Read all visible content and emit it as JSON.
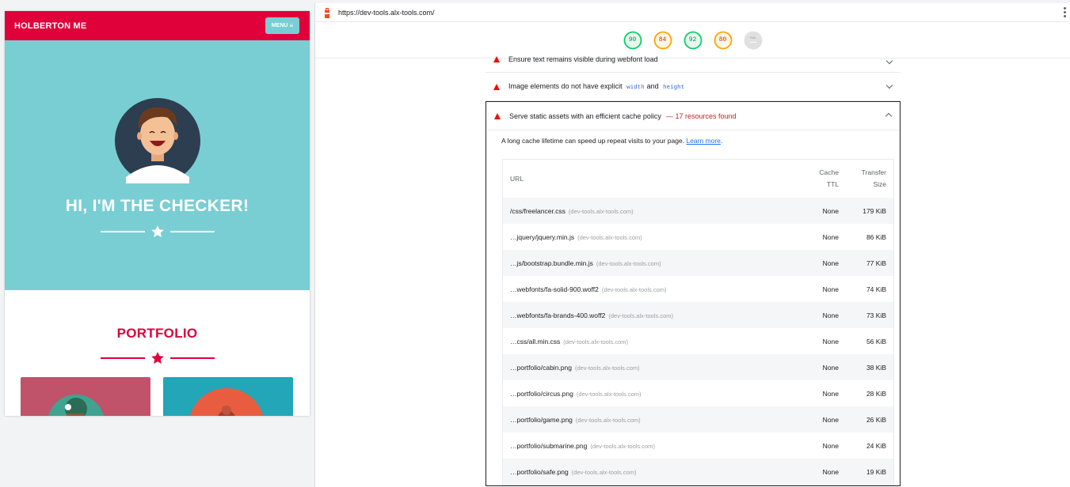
{
  "preview": {
    "brand": "HOLBERTON ME",
    "menu_label": "MENU",
    "hero_title": "HI, I'M THE CHECKER!",
    "portfolio_title": "PORTFOLIO"
  },
  "devtools": {
    "url": "https://dev-tools.alx-tools.com/",
    "scores": [
      {
        "value": "90",
        "color": "#0cce6b"
      },
      {
        "value": "84",
        "color": "#ffa400"
      },
      {
        "value": "92",
        "color": "#0cce6b"
      },
      {
        "value": "80",
        "color": "#ffa400"
      }
    ],
    "pwa_label": "PWA",
    "audits": {
      "webfont": "Ensure text remains visible during webfont load",
      "image_pre": "Image elements do not have explicit",
      "image_code1": "width",
      "image_and": "and",
      "image_code2": "height",
      "cache_title": "Serve static assets with an efficient cache policy",
      "cache_found": "— 17 resources found",
      "cache_desc": "A long cache lifetime can speed up repeat visits to your page.",
      "learn_more": "Learn more",
      "period": "."
    },
    "table": {
      "headers": {
        "url": "URL",
        "ttl_1": "Cache",
        "ttl_2": "TTL",
        "size_1": "Transfer",
        "size_2": "Size"
      },
      "rows": [
        {
          "url": "/css/freelancer.css",
          "host": "(dev-tools.alx-tools.com)",
          "ttl": "None",
          "size": "179 KiB"
        },
        {
          "url": "…jquery/jquery.min.js",
          "host": "(dev-tools.alx-tools.com)",
          "ttl": "None",
          "size": "86 KiB"
        },
        {
          "url": "…js/bootstrap.bundle.min.js",
          "host": "(dev-tools.alx-tools.com)",
          "ttl": "None",
          "size": "77 KiB"
        },
        {
          "url": "…webfonts/fa-solid-900.woff2",
          "host": "(dev-tools.alx-tools.com)",
          "ttl": "None",
          "size": "74 KiB"
        },
        {
          "url": "…webfonts/fa-brands-400.woff2",
          "host": "(dev-tools.alx-tools.com)",
          "ttl": "None",
          "size": "73 KiB"
        },
        {
          "url": "…css/all.min.css",
          "host": "(dev-tools.alx-tools.com)",
          "ttl": "None",
          "size": "56 KiB"
        },
        {
          "url": "…portfolio/cabin.png",
          "host": "(dev-tools.alx-tools.com)",
          "ttl": "None",
          "size": "38 KiB"
        },
        {
          "url": "…portfolio/circus.png",
          "host": "(dev-tools.alx-tools.com)",
          "ttl": "None",
          "size": "28 KiB"
        },
        {
          "url": "…portfolio/game.png",
          "host": "(dev-tools.alx-tools.com)",
          "ttl": "None",
          "size": "26 KiB"
        },
        {
          "url": "…portfolio/submarine.png",
          "host": "(dev-tools.alx-tools.com)",
          "ttl": "None",
          "size": "24 KiB"
        },
        {
          "url": "…portfolio/safe.png",
          "host": "(dev-tools.alx-tools.com)",
          "ttl": "None",
          "size": "19 KiB"
        }
      ]
    }
  }
}
